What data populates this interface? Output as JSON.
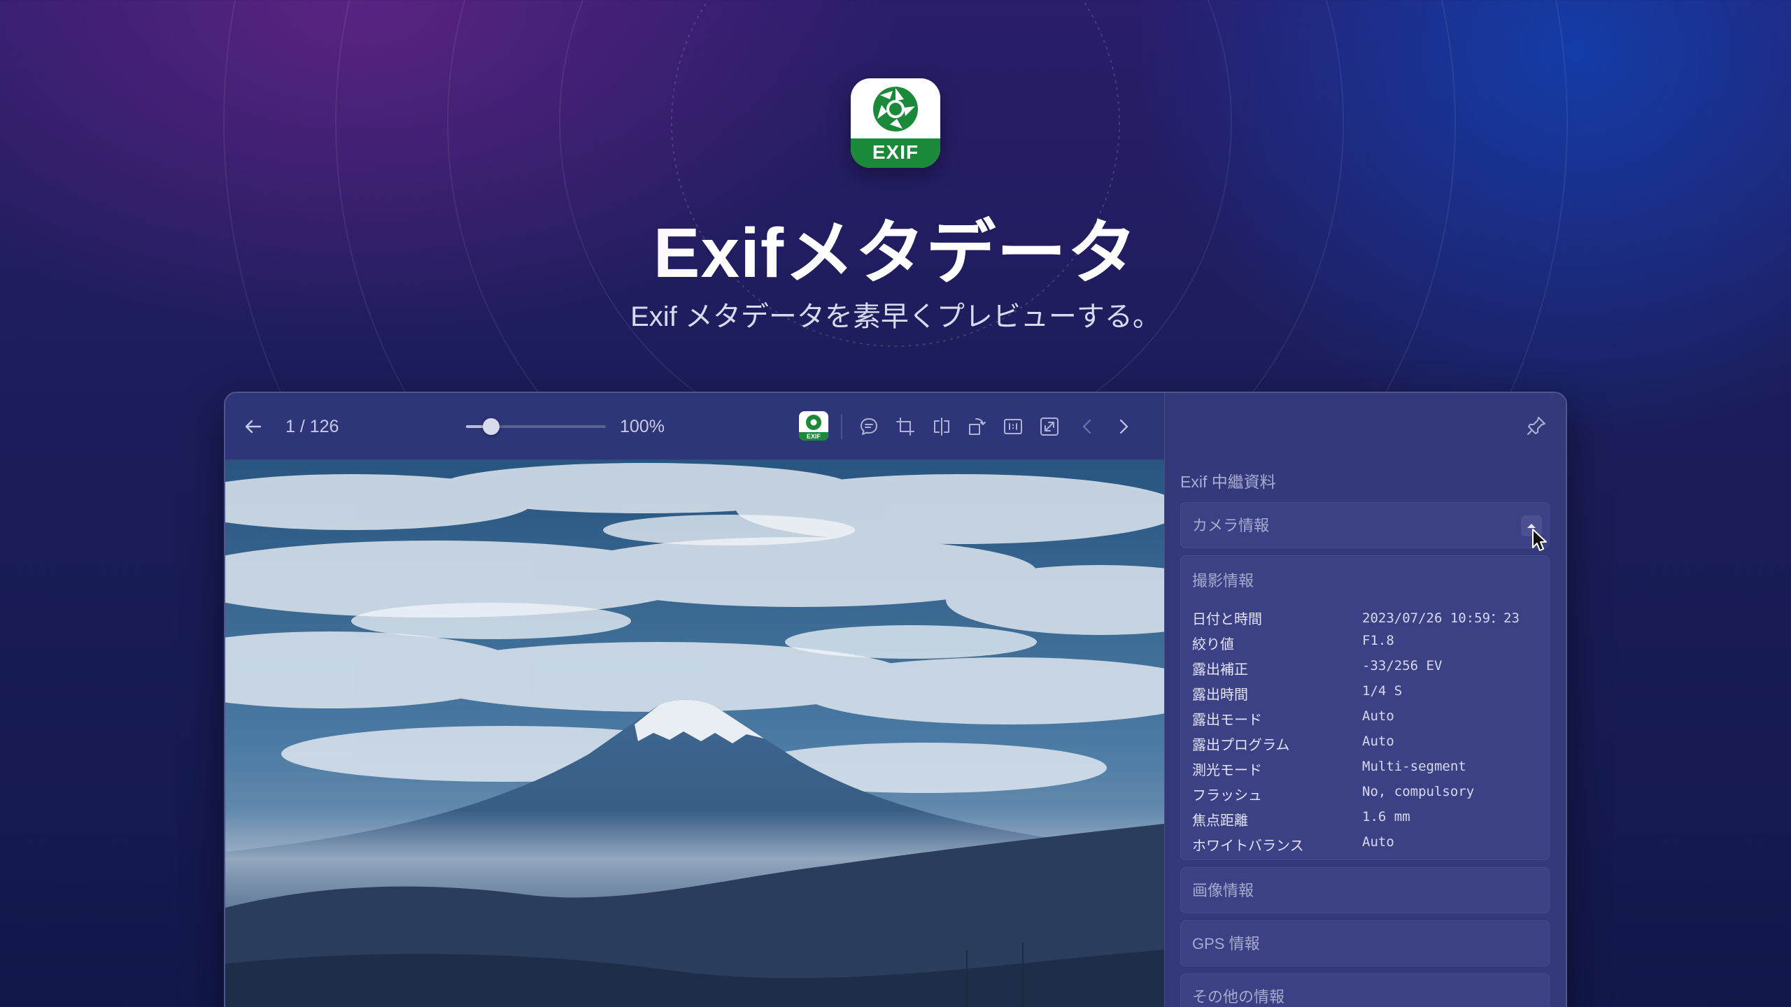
{
  "hero": {
    "app_icon_label": "EXIF",
    "title": "Exifメタデータ",
    "subtitle": "Exif メタデータを素早くプレビューする。"
  },
  "toolbar": {
    "page_counter": "1 / 126",
    "zoom_label": "100%",
    "zoom_value": 0.18,
    "exif_badge_label": "EXIF",
    "icons": [
      "back-arrow",
      "exif-app",
      "comment",
      "crop",
      "flip",
      "rotate",
      "actual-size",
      "fullscreen",
      "prev",
      "next"
    ]
  },
  "panel": {
    "title": "Exif 中繼資料",
    "sections": {
      "camera": {
        "label": "カメラ情報"
      },
      "shooting": {
        "label": "撮影情報",
        "rows": [
          {
            "key": "日付と時間",
            "value": "2023/07/26 10:59：23"
          },
          {
            "key": "絞り値",
            "value": "F1.8"
          },
          {
            "key": "露出補正",
            "value": "-33/256 EV"
          },
          {
            "key": "露出時間",
            "value": "1/4 S"
          },
          {
            "key": "露出モード",
            "value": "Auto"
          },
          {
            "key": "露出プログラム",
            "value": "Auto"
          },
          {
            "key": "測光モード",
            "value": "Multi-segment"
          },
          {
            "key": "フラッシュ",
            "value": "No, compulsory"
          },
          {
            "key": "焦点距離",
            "value": "1.6 mm"
          },
          {
            "key": "ホワイトバランス",
            "value": "Auto"
          }
        ]
      },
      "image": {
        "label": "画像情報"
      },
      "gps": {
        "label": "GPS 情報"
      },
      "other": {
        "label": "その他の情報"
      }
    }
  },
  "colors": {
    "accent_green": "#1a8a3a",
    "panel_bg": "#33397a",
    "card_bg": "#3b4184"
  }
}
